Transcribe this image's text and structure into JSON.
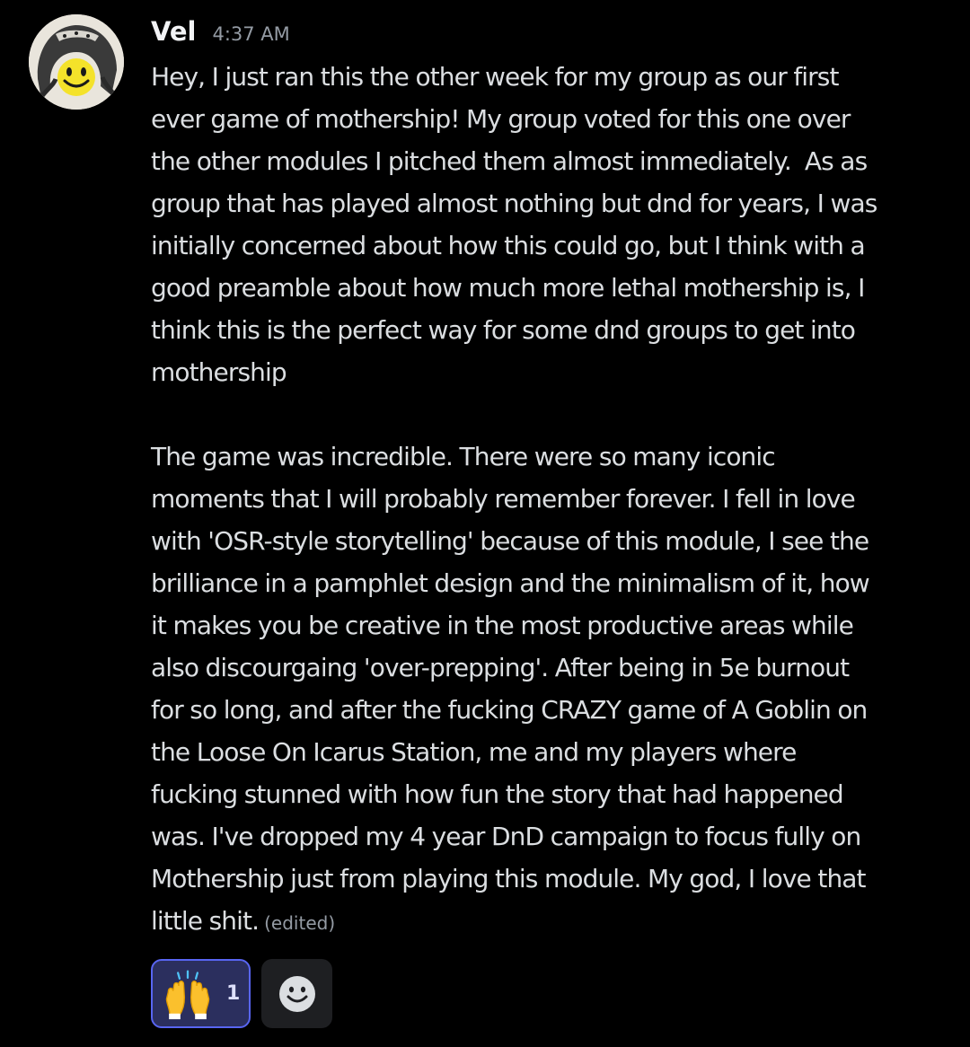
{
  "message": {
    "author": "Vel",
    "timestamp": "4:37 AM",
    "avatar_icon": "smiley-face-helmet-icon",
    "paragraphs": [
      {
        "lines": [
          "Hey, I just ran this the other week for my group as our first",
          "ever game of mothership! My group voted for this one over",
          "the other modules I pitched them almost immediately.  As as",
          "group that has played almost nothing but dnd for years, I was",
          "initially concerned about how this could go, but I think with a",
          "good preamble about how much more lethal mothership is, I",
          "think this is the perfect way for some dnd groups to get into",
          "mothership"
        ]
      },
      {
        "lines": [
          "The game was incredible. There were so many iconic",
          "moments that I will probably remember forever. I fell in love",
          "with 'OSR-style storytelling' because of this module, I see the",
          "brilliance in a pamphlet design and the minimalism of it, how",
          "it makes you be creative in the most productive areas while",
          "also discourgaing 'over-prepping'. After being in 5e burnout",
          "for so long, and after the fucking CRAZY game of A Goblin on",
          "the Loose On Icarus Station, me and my players where",
          "fucking stunned with how fun the story that had happened",
          "was. I've dropped my 4 year DnD campaign to focus fully on",
          "Mothership just from playing this module. My god, I love that",
          "little shit."
        ]
      }
    ],
    "edited_label": "(edited)"
  },
  "reactions": [
    {
      "emoji_icon": "raising-hands-emoji-icon",
      "count": "1",
      "selected": true
    }
  ],
  "add_reaction_icon": "add-reaction-smiley-icon",
  "colors": {
    "background": "#000000",
    "text": "#dbdee1",
    "username": "#f2f3f5",
    "muted": "#949ba4",
    "reaction_selected_bg": "#2b2f5e",
    "reaction_selected_border": "#5865f2",
    "add_reaction_bg": "#1e1f22"
  }
}
